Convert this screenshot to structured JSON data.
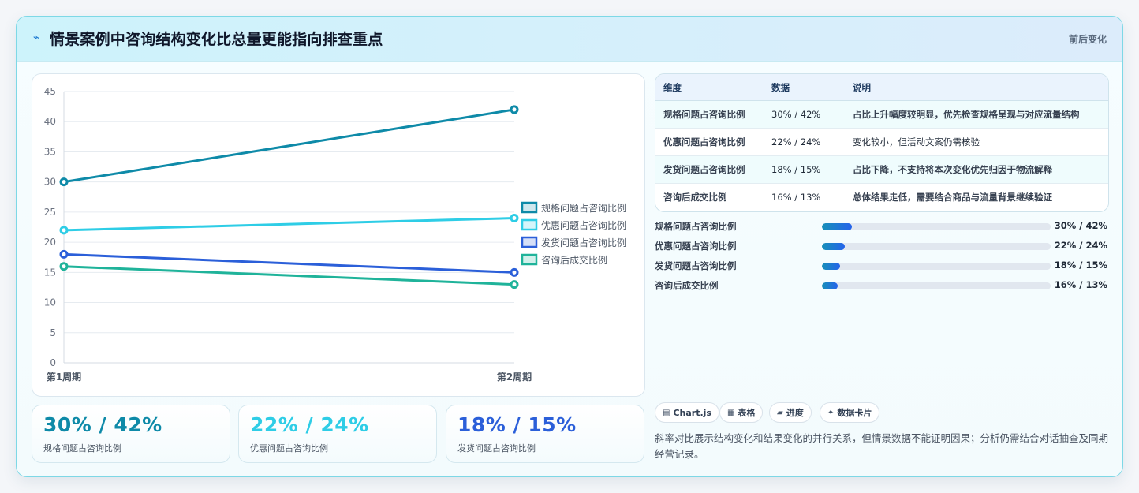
{
  "header": {
    "icon": "pulse-icon",
    "title": "情景案例中咨询结构变化比总量更能指向排查重点",
    "badge": "前后变化"
  },
  "chart_data": {
    "type": "line",
    "x": [
      "第1周期",
      "第2周期"
    ],
    "ylim": [
      0,
      45
    ],
    "yticks": [
      0,
      5,
      10,
      15,
      20,
      25,
      30,
      35,
      40,
      45
    ],
    "grid": true,
    "legend_position": "right",
    "series": [
      {
        "name": "规格问题占咨询比例",
        "values": [
          30,
          42
        ],
        "color": "#0e8aa8"
      },
      {
        "name": "优惠问题占咨询比例",
        "values": [
          22,
          24
        ],
        "color": "#2ecde6"
      },
      {
        "name": "发货问题占咨询比例",
        "values": [
          18,
          15
        ],
        "color": "#2b5fd9"
      },
      {
        "name": "咨询后成交比例",
        "values": [
          16,
          13
        ],
        "color": "#1fb39a"
      }
    ]
  },
  "kpis": [
    {
      "value": "30% / 42%",
      "label": "规格问题占咨询比例",
      "color": "#0e8aa8"
    },
    {
      "value": "22% / 24%",
      "label": "优惠问题占咨询比例",
      "color": "#2ecde6"
    },
    {
      "value": "18% / 15%",
      "label": "发货问题占咨询比例",
      "color": "#2b5fd9"
    }
  ],
  "table": {
    "headers": [
      "维度",
      "数据",
      "说明"
    ],
    "rows": [
      {
        "dim": "规格问题占咨询比例",
        "data": "30% / 42%",
        "desc": "占比上升幅度较明显，优先检查规格呈现与对应流量结构"
      },
      {
        "dim": "优惠问题占咨询比例",
        "data": "22% / 24%",
        "desc": "变化较小，但活动文案仍需核验"
      },
      {
        "dim": "发货问题占咨询比例",
        "data": "18% / 15%",
        "desc": "占比下降，不支持将本次变化优先归因于物流解释"
      },
      {
        "dim": "咨询后成交比例",
        "data": "16% / 13%",
        "desc": "总体结果走低，需要结合商品与流量背景继续验证"
      }
    ]
  },
  "progress": [
    {
      "label": "规格问题占咨询比例",
      "value": "30% / 42%",
      "level": 0.13
    },
    {
      "label": "优惠问题占咨询比例",
      "value": "22% / 24%",
      "level": 0.1
    },
    {
      "label": "发货问题占咨询比例",
      "value": "18% / 15%",
      "level": 0.08
    },
    {
      "label": "咨询后成交比例",
      "value": "16% / 13%",
      "level": 0.07
    }
  ],
  "chips": [
    {
      "icon": "chart-icon",
      "glyph": "▤",
      "label": "Chart.js"
    },
    {
      "icon": "table-icon",
      "glyph": "▦",
      "label": "表格"
    },
    {
      "icon": "progress-icon",
      "glyph": "▰",
      "label": "进度"
    },
    {
      "icon": "card-icon",
      "glyph": "✦",
      "label": "数据卡片"
    }
  ],
  "note": "斜率对比展示结构变化和结果变化的并行关系，但情景数据不能证明因果；分析仍需结合对话抽查及同期经营记录。"
}
